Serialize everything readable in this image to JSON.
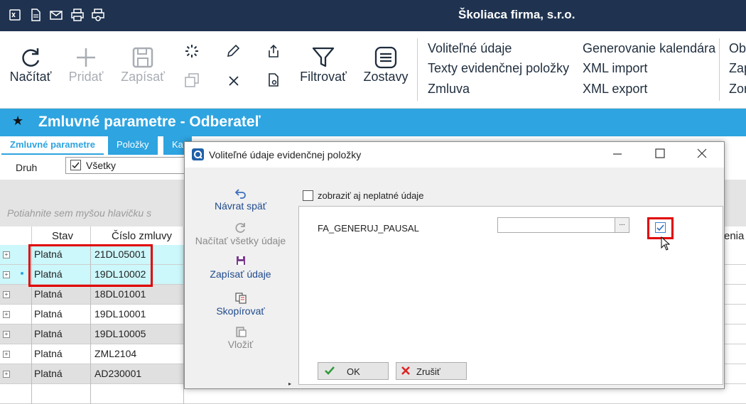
{
  "app": {
    "company": "Školiaca firma, s.r.o."
  },
  "quick_icons": [
    "excel-icon",
    "document-icon",
    "mail-icon",
    "print-icon",
    "print-preview-icon"
  ],
  "ribbon": {
    "reload": "Načítať",
    "add": "Pridať",
    "save": "Zapísať",
    "filter": "Filtrovať",
    "reports": "Zostavy",
    "links_col1": [
      "Voliteľné údaje",
      "Texty evidenčnej položky",
      "Zmluva"
    ],
    "links_col2": [
      "Generovanie kalendára",
      "XML import",
      "XML export"
    ],
    "links_col3": [
      "Obr",
      "Zap",
      "Zor"
    ]
  },
  "page": {
    "title": "Zmluvné parametre - Odberateľ"
  },
  "tabs": [
    "Zmluvné parametre",
    "Položky",
    "Ka"
  ],
  "filter": {
    "label": "Druh",
    "value": "Všetky"
  },
  "grid": {
    "group_hint": "Potiahnite sem myšou hlavičku s",
    "headers": {
      "stav": "Stav",
      "cislo": "Číslo zmluvy",
      "right": "enia"
    },
    "rows": [
      {
        "stav": "Platná",
        "cislo": "21DL05001"
      },
      {
        "stav": "Platná",
        "cislo": "19DL10002"
      },
      {
        "stav": "Platná",
        "cislo": "18DL01001"
      },
      {
        "stav": "Platná",
        "cislo": "19DL10001"
      },
      {
        "stav": "Platná",
        "cislo": "19DL10005"
      },
      {
        "stav": "Platná",
        "cislo": "ZML2104"
      },
      {
        "stav": "Platná",
        "cislo": "AD230001"
      }
    ]
  },
  "dialog": {
    "title": "Voliteľné údaje evidenčnej položky",
    "show_invalid": "zobraziť aj neplatné údaje",
    "actions": [
      "Návrat späť",
      "Načítať všetky údaje",
      "Zapísať údaje",
      "Skopírovať",
      "Vložiť"
    ],
    "field_name": "FA_GENERUJ_PAUSAL",
    "field_button": "...",
    "ok": "OK",
    "cancel": "Zrušiť"
  },
  "colors": {
    "topbar": "#1f3350",
    "accent": "#2ea4e0",
    "highlight_row": "#ccf7fb",
    "alt_row": "#e0e0e0",
    "annotation": "#e00000"
  }
}
